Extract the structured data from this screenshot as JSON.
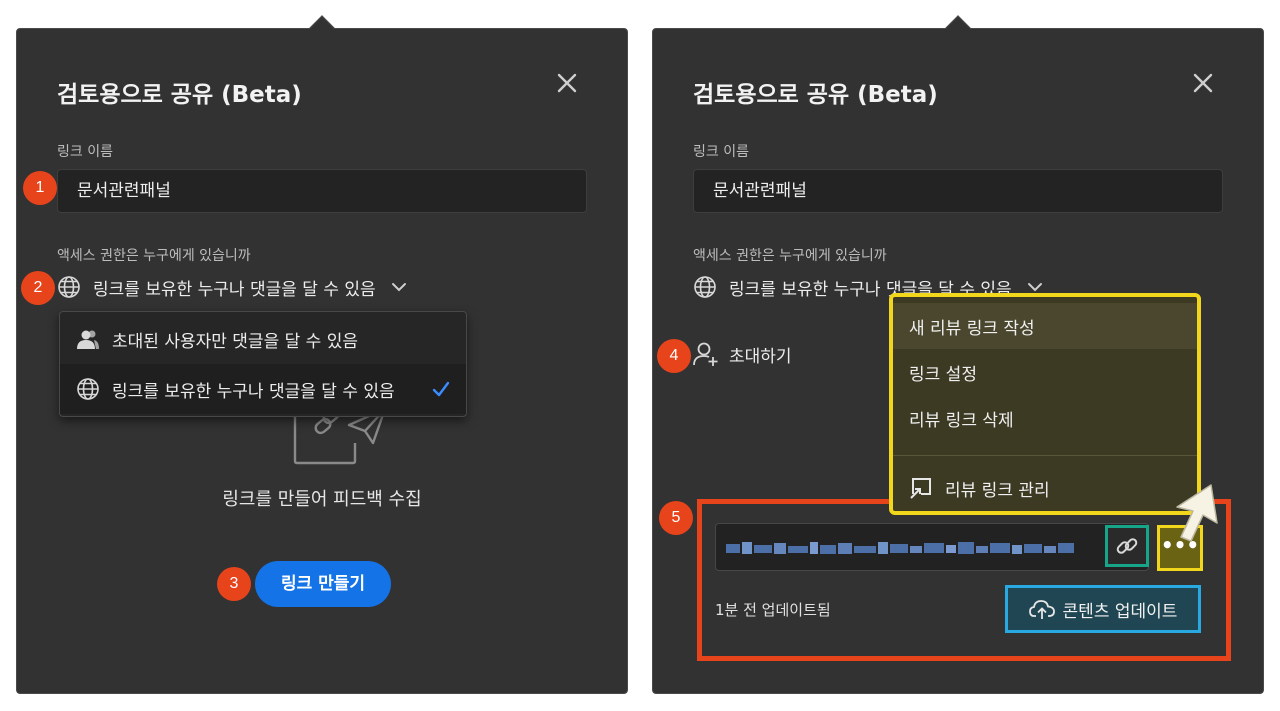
{
  "left_panel": {
    "title": "검토용으로 공유 (Beta)",
    "link_name_label": "링크 이름",
    "link_name_value": "문서관련패널",
    "access_label": "액세스 권한은 누구에게 있습니까",
    "access_selected": "링크를 보유한 누구나 댓글을 달 수 있음",
    "dropdown_options": [
      {
        "label": "초대된 사용자만 댓글을 달 수 있음",
        "icon": "users-icon",
        "selected": false
      },
      {
        "label": "링크를 보유한 누구나 댓글을 달 수 있음",
        "icon": "globe-icon",
        "selected": true
      }
    ],
    "empty_state_text": "링크를 만들어 피드백 수집",
    "create_button": "링크 만들기"
  },
  "right_panel": {
    "title": "검토용으로 공유 (Beta)",
    "link_name_label": "링크 이름",
    "link_name_value": "문서관련패널",
    "access_label": "액세스 권한은 누구에게 있습니까",
    "access_selected": "링크를 보유한 누구나 댓글을 달 수 있음",
    "invite_label": "초대하기",
    "more_menu": {
      "items": [
        "새 리뷰 링크 작성",
        "링크 설정",
        "리뷰 링크 삭제"
      ],
      "manage_label": "리뷰 링크 관리"
    },
    "more_button": "•••",
    "updated_text": "1분 전 업데이트됨",
    "update_button": "콘텐츠 업데이트"
  },
  "badges": [
    "1",
    "2",
    "3",
    "4",
    "5"
  ],
  "colors": {
    "panel_bg": "#323232",
    "accent_blue": "#1473e6",
    "badge_red": "#e8441c",
    "highlight_yellow": "#f2d61c",
    "highlight_teal": "#17a589",
    "highlight_cyan": "#29a9e1"
  }
}
